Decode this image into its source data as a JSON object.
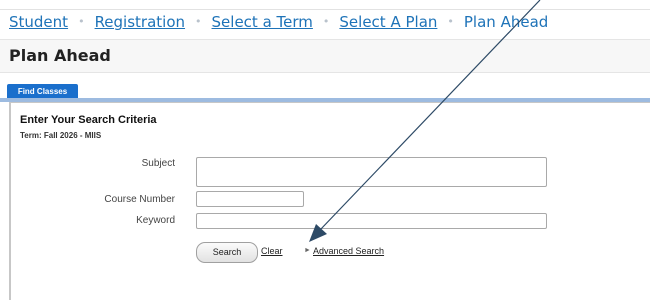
{
  "breadcrumb": {
    "items": [
      "Student",
      "Registration",
      "Select a Term",
      "Select A Plan"
    ],
    "current": "Plan Ahead",
    "separator": "•"
  },
  "page": {
    "title": "Plan Ahead"
  },
  "tabs": [
    {
      "label": "Find Classes",
      "active": true
    }
  ],
  "search": {
    "heading": "Enter Your Search Criteria",
    "term": "Term: Fall 2026 - MIIS",
    "fields": [
      {
        "label": "Subject",
        "value": ""
      },
      {
        "label": "Course Number",
        "value": ""
      },
      {
        "label": "Keyword",
        "value": ""
      }
    ],
    "search_button": "Search",
    "clear_link": "Clear",
    "advanced_link": "Advanced Search"
  },
  "colors": {
    "link": "#1e73b8",
    "tab_active": "#1a6fcc",
    "tab_strip": "#9dbbe0",
    "annotation_arrow": "#2d4a66"
  },
  "icons": {
    "advanced_toggle": "triangle-right-icon",
    "annotation": "arrow-pointer-icon"
  }
}
